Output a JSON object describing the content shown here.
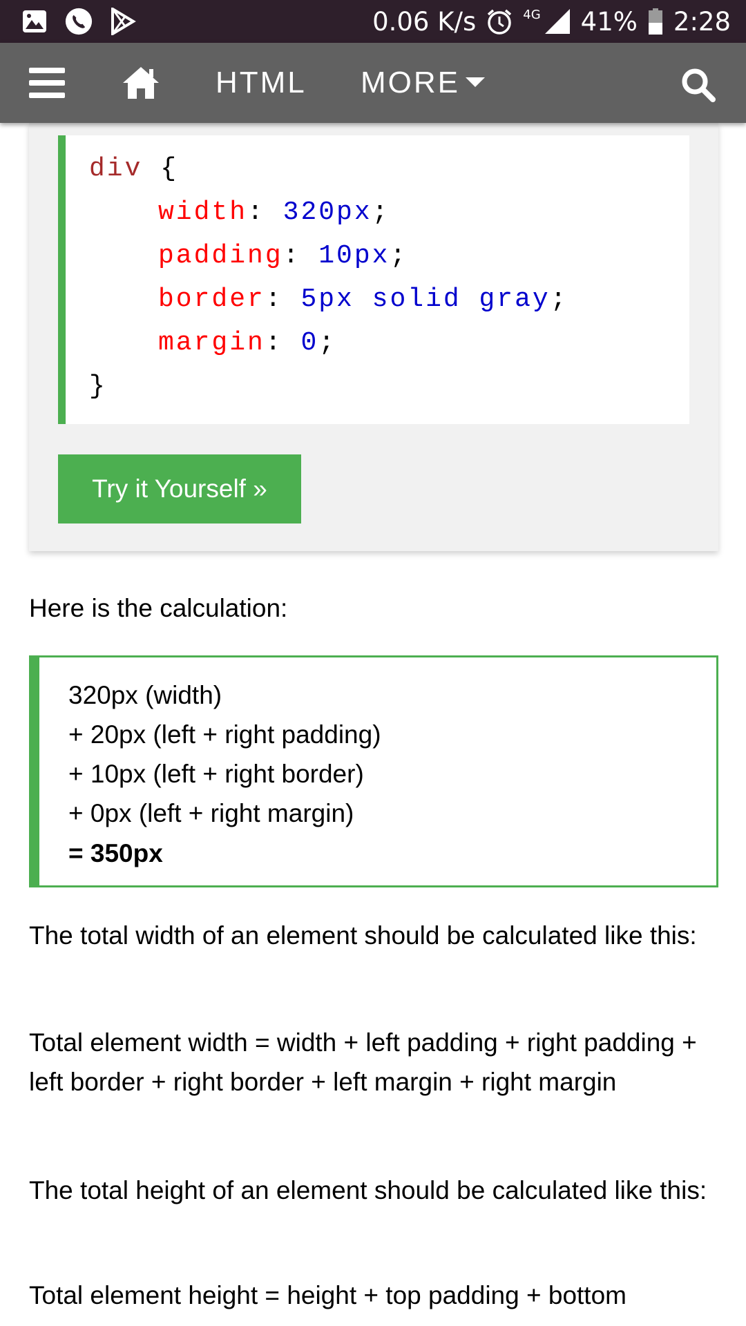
{
  "status_bar": {
    "net_speed": "0.06 K/s",
    "network_type": "4G",
    "battery": "41%",
    "time": "2:28",
    "icons": [
      "gallery-icon",
      "phone-icon",
      "play-store-icon",
      "alarm-icon",
      "signal-icon",
      "battery-icon"
    ]
  },
  "navbar": {
    "html_label": "HTML",
    "more_label": "MORE",
    "icons": [
      "menu-icon",
      "home-icon",
      "search-icon"
    ],
    "background": "#616161"
  },
  "code_example": {
    "selector": "div",
    "open_brace": "{",
    "close_brace": "}",
    "declarations": [
      {
        "property": "width",
        "value": "320px"
      },
      {
        "property": "padding",
        "value": "10px"
      },
      {
        "property": "border",
        "value": "5px solid gray"
      },
      {
        "property": "margin",
        "value": "0"
      }
    ],
    "accent": "#4caf50"
  },
  "try_button_label": "Try it Yourself »",
  "calc_intro": "Here is the calculation:",
  "calculation": {
    "lines": [
      "320px (width)",
      "+ 20px (left + right padding)",
      "+ 10px (left + right border)",
      "+ 0px (left + right margin)"
    ],
    "total": "= 350px"
  },
  "paragraphs": {
    "width_intro": "The total width of an element should be calculated like this:",
    "width_formula": "Total element width = width + left padding + right padding + left border + right border + left margin + right margin",
    "height_intro": "The total height of an element should be calculated like this:",
    "height_formula": "Total element height = height + top padding + bottom"
  }
}
